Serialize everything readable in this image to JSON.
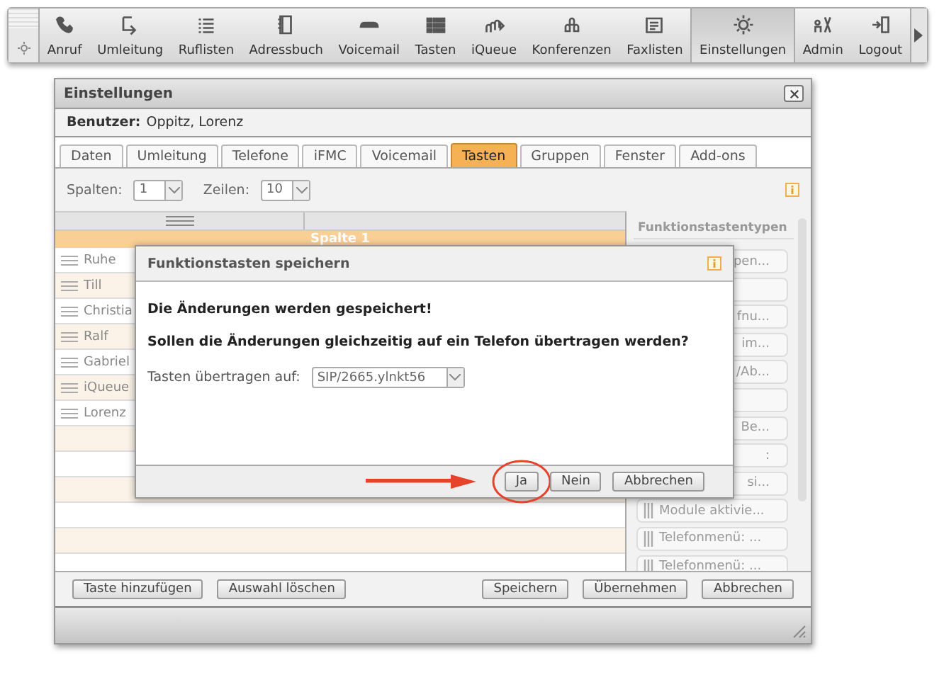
{
  "toolbar": {
    "items": [
      {
        "label": "Anruf",
        "selected": false
      },
      {
        "label": "Umleitung",
        "selected": false
      },
      {
        "label": "Ruflisten",
        "selected": false
      },
      {
        "label": "Adressbuch",
        "selected": false
      },
      {
        "label": "Voicemail",
        "selected": false
      },
      {
        "label": "Tasten",
        "selected": false
      },
      {
        "label": "iQueue",
        "selected": false
      },
      {
        "label": "Konferenzen",
        "selected": false
      },
      {
        "label": "Faxlisten",
        "selected": false
      },
      {
        "label": "Einstellungen",
        "selected": true
      },
      {
        "label": "Admin",
        "selected": false
      },
      {
        "label": "Logout",
        "selected": false
      }
    ]
  },
  "window": {
    "title": "Einstellungen",
    "user_label": "Benutzer:",
    "user_name": "Oppitz, Lorenz",
    "tabs": [
      {
        "label": "Daten",
        "selected": false
      },
      {
        "label": "Umleitung",
        "selected": false
      },
      {
        "label": "Telefone",
        "selected": false
      },
      {
        "label": "iFMC",
        "selected": false
      },
      {
        "label": "Voicemail",
        "selected": false
      },
      {
        "label": "Tasten",
        "selected": true
      },
      {
        "label": "Gruppen",
        "selected": false
      },
      {
        "label": "Fenster",
        "selected": false
      },
      {
        "label": "Add-ons",
        "selected": false
      }
    ],
    "columns_select": {
      "label": "Spalten:",
      "value": "1"
    },
    "rows_select": {
      "label": "Zeilen:",
      "value": "10"
    },
    "table": {
      "column_header": "Spalte 1",
      "rows": [
        "Ruhe",
        "Till",
        "Christia",
        "Ralf",
        "Gabriel",
        "iQueue",
        "Lorenz"
      ]
    },
    "types_panel": {
      "title": "Funktionstastentypen",
      "items": [
        {
          "kind": "partial",
          "text": "pen..."
        },
        {
          "kind": "hidden"
        },
        {
          "kind": "partial",
          "text": "fnu..."
        },
        {
          "kind": "partial",
          "text": "im..."
        },
        {
          "kind": "partial",
          "text": "/Ab..."
        },
        {
          "kind": "hidden"
        },
        {
          "kind": "partial",
          "text": "Be..."
        },
        {
          "kind": "partial",
          "text": ":"
        },
        {
          "kind": "partial",
          "text": "si..."
        },
        {
          "kind": "full",
          "text": "Module aktivie..."
        },
        {
          "kind": "full",
          "text": "Telefonmenü: ..."
        },
        {
          "kind": "full",
          "text": "Telefonmenü: ..."
        }
      ]
    },
    "footer": {
      "left_buttons": [
        "Taste hinzufügen",
        "Auswahl löschen"
      ],
      "right_buttons": [
        "Speichern",
        "Übernehmen",
        "Abbrechen"
      ]
    }
  },
  "dialog": {
    "title": "Funktionstasten speichern",
    "message": "Die Änderungen werden gespeichert!",
    "question": "Sollen die Änderungen gleichzeitig auf ein Telefon übertragen werden?",
    "target_label": "Tasten übertragen auf:",
    "target_value": "SIP/2665.ylnkt56",
    "buttons": [
      {
        "label": "Ja",
        "highlighted": true
      },
      {
        "label": "Nein",
        "highlighted": false
      },
      {
        "label": "Abbrechen",
        "highlighted": false
      }
    ]
  }
}
